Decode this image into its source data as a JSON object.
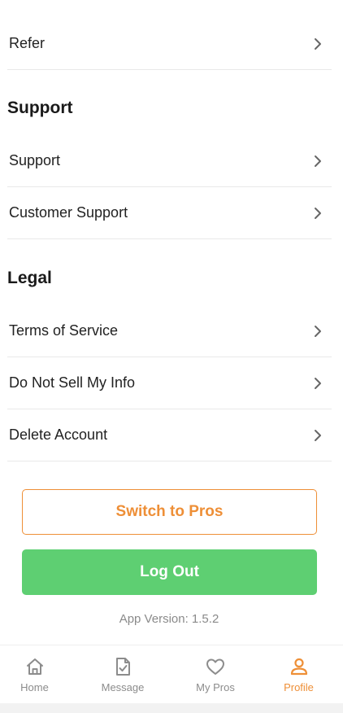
{
  "rows": {
    "refer": "Refer",
    "support": "Support",
    "customer_support": "Customer Support",
    "terms": "Terms of Service",
    "do_not_sell": "Do Not Sell My Info",
    "delete_account": "Delete Account"
  },
  "sections": {
    "support": "Support",
    "legal": "Legal"
  },
  "buttons": {
    "switch_to_pros": "Switch to Pros",
    "log_out": "Log Out"
  },
  "app_version": "App Version: 1.5.2",
  "tabs": {
    "home": "Home",
    "message": "Message",
    "my_pros": "My Pros",
    "profile": "Profile"
  },
  "colors": {
    "accent": "#ee8f37",
    "logout_green": "#5ecf72",
    "inactive": "#8c8c8c"
  },
  "icons": {
    "chevron": "chevron-right-icon",
    "home": "home-icon",
    "message": "document-check-icon",
    "my_pros": "heart-icon",
    "profile": "user-icon"
  }
}
